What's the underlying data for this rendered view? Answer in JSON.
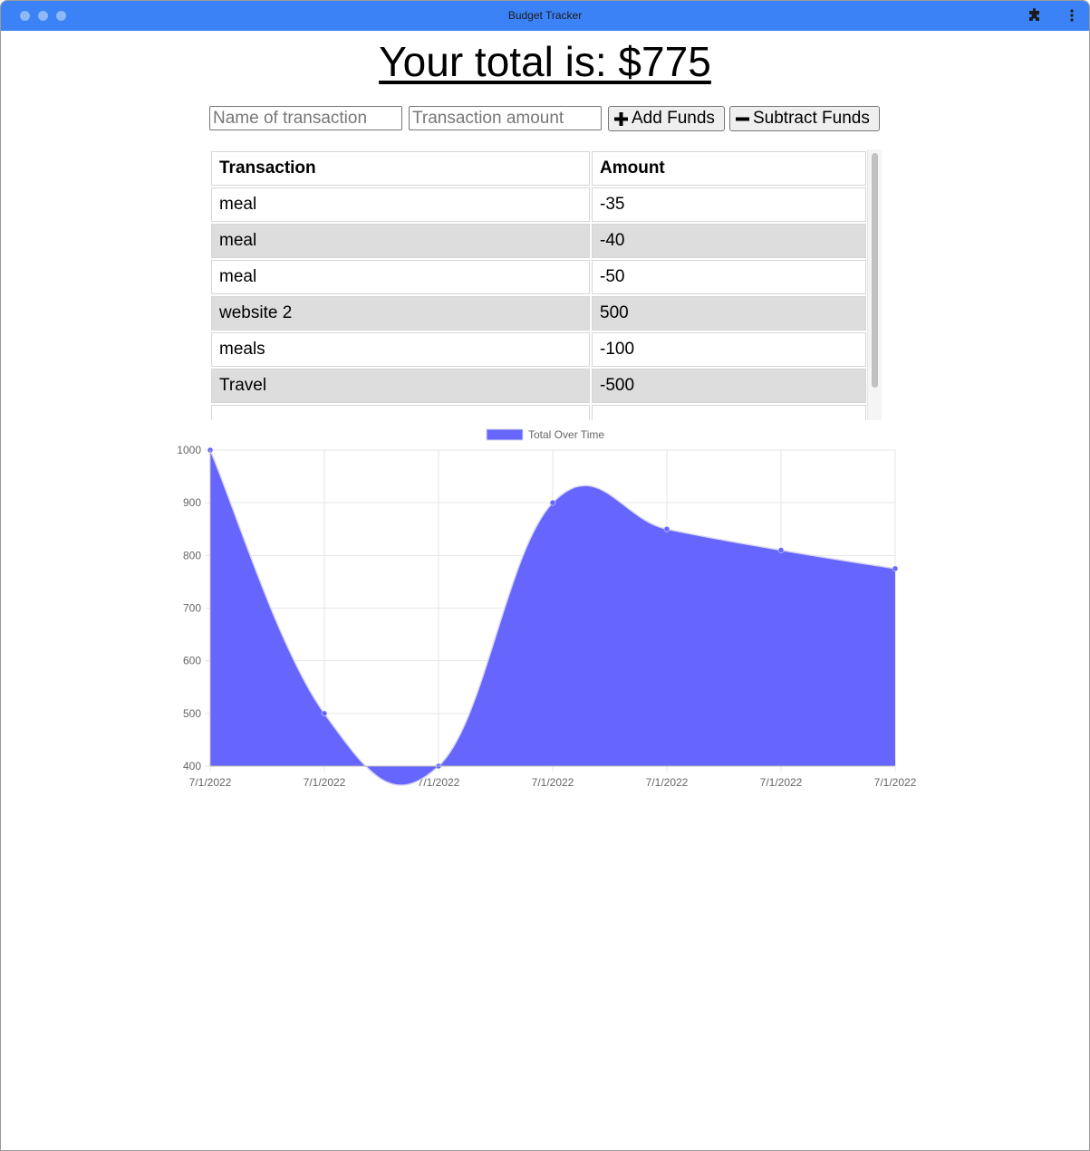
{
  "window": {
    "title": "Budget Tracker",
    "accent_color": "#3b82f6"
  },
  "header": {
    "total_label": "Your total is: $",
    "total_value": "775"
  },
  "form": {
    "name_placeholder": "Name of transaction",
    "amount_placeholder": "Transaction amount",
    "add_label": "Add Funds",
    "subtract_label": "Subtract Funds",
    "add_icon": "plus-icon",
    "subtract_icon": "minus-icon"
  },
  "table": {
    "headers": [
      "Transaction",
      "Amount"
    ],
    "rows": [
      {
        "name": "meal",
        "amount": "-35"
      },
      {
        "name": "meal",
        "amount": "-40"
      },
      {
        "name": "meal",
        "amount": "-50"
      },
      {
        "name": "website 2",
        "amount": "500"
      },
      {
        "name": "meals",
        "amount": "-100"
      },
      {
        "name": "Travel",
        "amount": "-500"
      }
    ]
  },
  "chart_data": {
    "type": "area",
    "x": [
      "7/1/2022",
      "7/1/2022",
      "7/1/2022",
      "7/1/2022",
      "7/1/2022",
      "7/1/2022",
      "7/1/2022"
    ],
    "series": [
      {
        "name": "Total Over Time",
        "values": [
          1000,
          500,
          400,
          900,
          850,
          810,
          775
        ],
        "color": "#6666ff"
      }
    ],
    "ylim": [
      400,
      1000
    ],
    "yticks": [
      400,
      500,
      600,
      700,
      800,
      900,
      1000
    ],
    "grid": true,
    "legend": "top"
  }
}
